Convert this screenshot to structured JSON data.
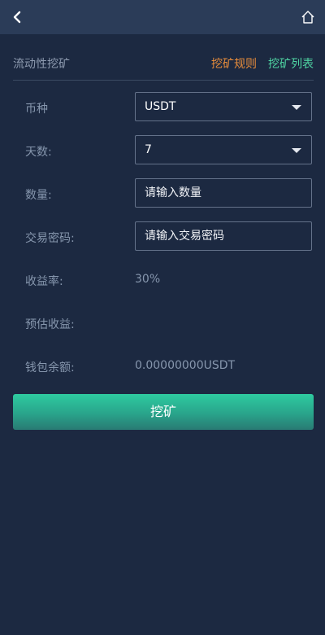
{
  "header": {
    "back_icon": "chevron-left-icon",
    "home_icon": "home-icon"
  },
  "page": {
    "title": "流动性挖矿",
    "rules_link": "挖矿规则",
    "list_link": "挖矿列表"
  },
  "form": {
    "currency": {
      "label": "币种",
      "value": "USDT"
    },
    "days": {
      "label": "天数:",
      "value": "7"
    },
    "amount": {
      "label": "数量:",
      "placeholder": "请输入数量"
    },
    "password": {
      "label": "交易密码:",
      "placeholder": "请输入交易密码"
    },
    "yield_rate": {
      "label": "收益率:",
      "value": "30%"
    },
    "estimated_income": {
      "label": "预估收益:",
      "value": ""
    },
    "wallet_balance": {
      "label": "钱包余额:",
      "value": "0.00000000USDT"
    }
  },
  "actions": {
    "submit_label": "挖矿"
  },
  "colors": {
    "background": "#1c2941",
    "header": "#2b3c58",
    "rules_link": "#e98d3b",
    "list_link": "#4fd5a3",
    "button_top": "#2ecba0",
    "button_bottom": "#297a73"
  }
}
